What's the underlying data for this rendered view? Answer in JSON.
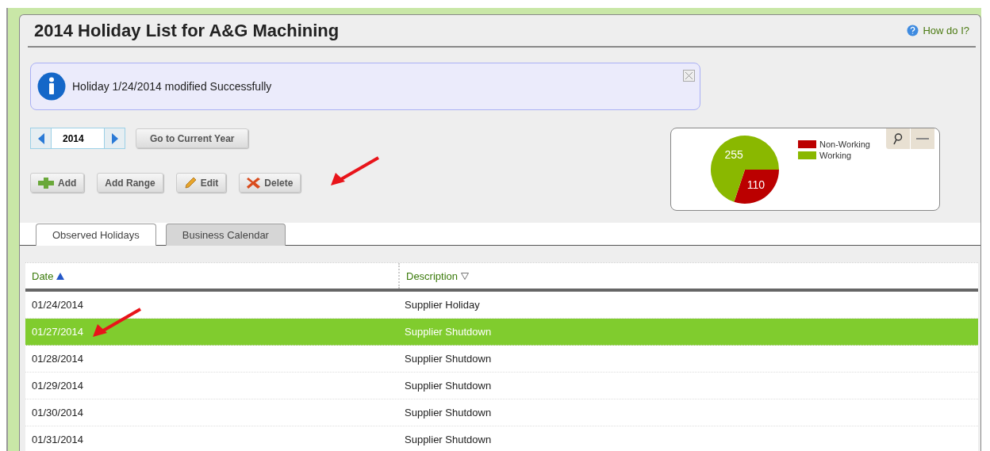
{
  "page": {
    "title": "2014 Holiday List for A&G Machining",
    "help_link": "How do I?"
  },
  "message": {
    "text": "Holiday 1/24/2014 modified Successfully"
  },
  "year_nav": {
    "value": "2014",
    "button": "Go to Current Year"
  },
  "actions": [
    {
      "label": "Add",
      "kind": "add"
    },
    {
      "label": "Add Range",
      "kind": "plain"
    },
    {
      "label": "Edit",
      "kind": "edit"
    },
    {
      "label": "Delete",
      "kind": "delete"
    }
  ],
  "chart": {
    "chart_data": {
      "type": "pie",
      "data_labels": true,
      "legend": "right",
      "categories": [
        "Non-Working",
        "Working"
      ],
      "series": [
        {
          "values": [
            110,
            255
          ]
        }
      ]
    },
    "slices": [
      {
        "color": "#bb0000"
      },
      {
        "color": "#8ab800"
      }
    ]
  },
  "tabs": [
    {
      "label": "Observed Holidays",
      "selected": true
    },
    {
      "label": "Business Calendar",
      "selected": false
    }
  ],
  "table": {
    "columns": [
      {
        "label": "Date",
        "sorted": true
      },
      {
        "label": "Description",
        "sorted": false
      }
    ],
    "rows": [
      {
        "date": "01/24/2014",
        "description": "Supplier Holiday",
        "selected": false
      },
      {
        "date": "01/27/2014",
        "description": "Supplier Shutdown",
        "selected": true
      },
      {
        "date": "01/28/2014",
        "description": "Supplier Shutdown",
        "selected": false
      },
      {
        "date": "01/29/2014",
        "description": "Supplier Shutdown",
        "selected": false
      },
      {
        "date": "01/30/2014",
        "description": "Supplier Shutdown",
        "selected": false
      },
      {
        "date": "01/31/2014",
        "description": "Supplier Shutdown",
        "selected": false
      }
    ]
  }
}
